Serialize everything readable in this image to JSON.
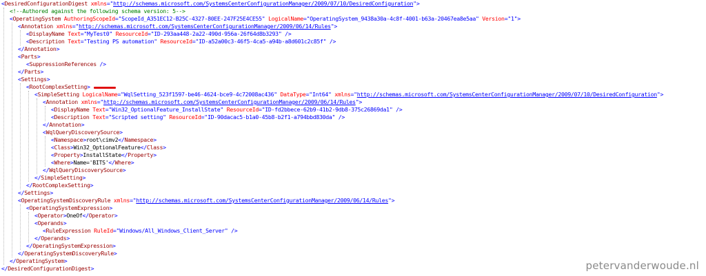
{
  "document": {
    "lines": [
      {
        "indent": 0,
        "parts": [
          [
            "tb",
            "<"
          ],
          [
            "tn",
            "DesiredConfigurationDigest"
          ],
          [
            "tx",
            " "
          ],
          [
            "an",
            "xmlns"
          ],
          [
            "tb",
            "=\""
          ],
          [
            "url",
            "http://schemas.microsoft.com/SystemsCenterConfigurationManager/2009/07/10/DesiredConfiguration"
          ],
          [
            "tb",
            "\">"
          ]
        ]
      },
      {
        "indent": 1,
        "parts": [
          [
            "cm",
            "<!--Authored against the following schema version: 5-->"
          ]
        ]
      },
      {
        "indent": 1,
        "parts": [
          [
            "tb",
            "<"
          ],
          [
            "tn",
            "OperatingSystem"
          ],
          [
            "tx",
            " "
          ],
          [
            "an",
            "AuthoringScopeId"
          ],
          [
            "tb",
            "=\""
          ],
          [
            "av",
            "ScopeId_A351EC12-B25C-4327-80EE-247F25E4CE55"
          ],
          [
            "tb",
            "\""
          ],
          [
            "tx",
            " "
          ],
          [
            "an",
            "LogicalName"
          ],
          [
            "tb",
            "=\""
          ],
          [
            "av",
            "OperatingSystem_9438a30a-4c8f-4001-b63a-20467ea8e5aa"
          ],
          [
            "tb",
            "\""
          ],
          [
            "tx",
            " "
          ],
          [
            "an",
            "Version"
          ],
          [
            "tb",
            "=\""
          ],
          [
            "av",
            "1"
          ],
          [
            "tb",
            "\">"
          ]
        ]
      },
      {
        "indent": 2,
        "parts": [
          [
            "tb",
            "<"
          ],
          [
            "tn",
            "Annotation"
          ],
          [
            "tx",
            " "
          ],
          [
            "an",
            "xmlns"
          ],
          [
            "tb",
            "=\""
          ],
          [
            "url",
            "http://schemas.microsoft.com/SystemsCenterConfigurationManager/2009/06/14/Rules"
          ],
          [
            "tb",
            "\">"
          ]
        ]
      },
      {
        "indent": 3,
        "parts": [
          [
            "tb",
            "<"
          ],
          [
            "tn",
            "DisplayName"
          ],
          [
            "tx",
            " "
          ],
          [
            "an",
            "Text"
          ],
          [
            "tb",
            "=\""
          ],
          [
            "av",
            "MyTest0"
          ],
          [
            "tb",
            "\""
          ],
          [
            "tx",
            " "
          ],
          [
            "an",
            "ResourceId"
          ],
          [
            "tb",
            "=\""
          ],
          [
            "av",
            "ID-293aa448-2a22-490d-956a-26f64d8b3293"
          ],
          [
            "tb",
            "\" />"
          ]
        ]
      },
      {
        "indent": 3,
        "parts": [
          [
            "tb",
            "<"
          ],
          [
            "tn",
            "Description"
          ],
          [
            "tx",
            " "
          ],
          [
            "an",
            "Text"
          ],
          [
            "tb",
            "=\""
          ],
          [
            "av",
            "Testing PS automation"
          ],
          [
            "tb",
            "\""
          ],
          [
            "tx",
            " "
          ],
          [
            "an",
            "ResourceId"
          ],
          [
            "tb",
            "=\""
          ],
          [
            "av",
            "ID-a52a00c3-46f5-4ca5-a94b-a8d601c2c85f"
          ],
          [
            "tb",
            "\" />"
          ]
        ]
      },
      {
        "indent": 2,
        "parts": [
          [
            "tb",
            "</"
          ],
          [
            "tn",
            "Annotation"
          ],
          [
            "tb",
            ">"
          ]
        ]
      },
      {
        "indent": 2,
        "parts": [
          [
            "tb",
            "<"
          ],
          [
            "tn",
            "Parts"
          ],
          [
            "tb",
            ">"
          ]
        ]
      },
      {
        "indent": 3,
        "parts": [
          [
            "tb",
            "<"
          ],
          [
            "tn",
            "SuppressionReferences"
          ],
          [
            "tb",
            " />"
          ]
        ]
      },
      {
        "indent": 2,
        "parts": [
          [
            "tb",
            "</"
          ],
          [
            "tn",
            "Parts"
          ],
          [
            "tb",
            ">"
          ]
        ]
      },
      {
        "indent": 2,
        "parts": [
          [
            "tb",
            "<"
          ],
          [
            "tn",
            "Settings"
          ],
          [
            "tb",
            ">"
          ]
        ]
      },
      {
        "indent": 3,
        "parts": [
          [
            "tb",
            "<"
          ],
          [
            "tn",
            "RootComplexSetting"
          ],
          [
            "tb",
            ">"
          ]
        ]
      },
      {
        "indent": 4,
        "parts": [
          [
            "tb",
            "<"
          ],
          [
            "tn",
            "SimpleSetting"
          ],
          [
            "tx",
            " "
          ],
          [
            "an",
            "LogicalName"
          ],
          [
            "tb",
            "=\""
          ],
          [
            "av",
            "WqlSetting_523f1597-be46-4624-bce9-4c72008ac436"
          ],
          [
            "tb",
            "\""
          ],
          [
            "tx",
            " "
          ],
          [
            "an",
            "DataType"
          ],
          [
            "tb",
            "=\""
          ],
          [
            "av",
            "Int64"
          ],
          [
            "tb",
            "\""
          ],
          [
            "tx",
            " "
          ],
          [
            "an",
            "xmlns"
          ],
          [
            "tb",
            "=\""
          ],
          [
            "url",
            "http://schemas.microsoft.com/SystemsCenterConfigurationManager/2009/07/10/DesiredConfiguration"
          ],
          [
            "tb",
            "\">"
          ]
        ]
      },
      {
        "indent": 5,
        "parts": [
          [
            "tb",
            "<"
          ],
          [
            "tn",
            "Annotation"
          ],
          [
            "tx",
            " "
          ],
          [
            "an",
            "xmlns"
          ],
          [
            "tb",
            "=\""
          ],
          [
            "url",
            "http://schemas.microsoft.com/SystemsCenterConfigurationManager/2009/06/14/Rules"
          ],
          [
            "tb",
            "\">"
          ]
        ]
      },
      {
        "indent": 6,
        "parts": [
          [
            "tb",
            "<"
          ],
          [
            "tn",
            "DisplayName"
          ],
          [
            "tx",
            " "
          ],
          [
            "an",
            "Text"
          ],
          [
            "tb",
            "=\""
          ],
          [
            "av",
            "Win32_OptionalFeature_InstallState"
          ],
          [
            "tb",
            "\""
          ],
          [
            "tx",
            " "
          ],
          [
            "an",
            "ResourceId"
          ],
          [
            "tb",
            "=\""
          ],
          [
            "av",
            "ID-fd2bbece-62b9-41b2-9db8-375c26869da1"
          ],
          [
            "tb",
            "\" />"
          ]
        ]
      },
      {
        "indent": 6,
        "parts": [
          [
            "tb",
            "<"
          ],
          [
            "tn",
            "Description"
          ],
          [
            "tx",
            " "
          ],
          [
            "an",
            "Text"
          ],
          [
            "tb",
            "=\""
          ],
          [
            "av",
            "Scripted setting"
          ],
          [
            "tb",
            "\""
          ],
          [
            "tx",
            " "
          ],
          [
            "an",
            "ResourceId"
          ],
          [
            "tb",
            "=\""
          ],
          [
            "av",
            "ID-90dacac5-b1a0-45b8-b2f1-a794bbd830da"
          ],
          [
            "tb",
            "\" />"
          ]
        ]
      },
      {
        "indent": 5,
        "parts": [
          [
            "tb",
            "</"
          ],
          [
            "tn",
            "Annotation"
          ],
          [
            "tb",
            ">"
          ]
        ]
      },
      {
        "indent": 5,
        "parts": [
          [
            "tb",
            "<"
          ],
          [
            "tn",
            "WqlQueryDiscoverySource"
          ],
          [
            "tb",
            ">"
          ]
        ]
      },
      {
        "indent": 6,
        "parts": [
          [
            "tb",
            "<"
          ],
          [
            "tn",
            "Namespace"
          ],
          [
            "tb",
            ">"
          ],
          [
            "tx",
            "root\\cimv2"
          ],
          [
            "tb",
            "</"
          ],
          [
            "tn",
            "Namespace"
          ],
          [
            "tb",
            ">"
          ]
        ]
      },
      {
        "indent": 6,
        "parts": [
          [
            "tb",
            "<"
          ],
          [
            "tn",
            "Class"
          ],
          [
            "tb",
            ">"
          ],
          [
            "tx",
            "Win32_OptionalFeature"
          ],
          [
            "tb",
            "</"
          ],
          [
            "tn",
            "Class"
          ],
          [
            "tb",
            ">"
          ]
        ]
      },
      {
        "indent": 6,
        "parts": [
          [
            "tb",
            "<"
          ],
          [
            "tn",
            "Property"
          ],
          [
            "tb",
            ">"
          ],
          [
            "tx",
            "InstallState"
          ],
          [
            "tb",
            "</"
          ],
          [
            "tn",
            "Property"
          ],
          [
            "tb",
            ">"
          ]
        ]
      },
      {
        "indent": 6,
        "parts": [
          [
            "tb",
            "<"
          ],
          [
            "tn",
            "Where"
          ],
          [
            "tb",
            ">"
          ],
          [
            "tx",
            "Name='BITS'"
          ],
          [
            "tb",
            "</"
          ],
          [
            "tn",
            "Where"
          ],
          [
            "tb",
            ">"
          ]
        ]
      },
      {
        "indent": 5,
        "parts": [
          [
            "tb",
            "</"
          ],
          [
            "tn",
            "WqlQueryDiscoverySource"
          ],
          [
            "tb",
            ">"
          ]
        ]
      },
      {
        "indent": 4,
        "parts": [
          [
            "tb",
            "</"
          ],
          [
            "tn",
            "SimpleSetting"
          ],
          [
            "tb",
            ">"
          ]
        ]
      },
      {
        "indent": 3,
        "parts": [
          [
            "tb",
            "</"
          ],
          [
            "tn",
            "RootComplexSetting"
          ],
          [
            "tb",
            ">"
          ]
        ]
      },
      {
        "indent": 2,
        "parts": [
          [
            "tb",
            "</"
          ],
          [
            "tn",
            "Settings"
          ],
          [
            "tb",
            ">"
          ]
        ]
      },
      {
        "indent": 2,
        "parts": [
          [
            "tb",
            "<"
          ],
          [
            "tn",
            "OperatingSystemDiscoveryRule"
          ],
          [
            "tx",
            " "
          ],
          [
            "an",
            "xmlns"
          ],
          [
            "tb",
            "=\""
          ],
          [
            "url",
            "http://schemas.microsoft.com/SystemsCenterConfigurationManager/2009/06/14/Rules"
          ],
          [
            "tb",
            "\">"
          ]
        ]
      },
      {
        "indent": 3,
        "parts": [
          [
            "tb",
            "<"
          ],
          [
            "tn",
            "OperatingSystemExpression"
          ],
          [
            "tb",
            ">"
          ]
        ]
      },
      {
        "indent": 4,
        "parts": [
          [
            "tb",
            "<"
          ],
          [
            "tn",
            "Operator"
          ],
          [
            "tb",
            ">"
          ],
          [
            "tx",
            "OneOf"
          ],
          [
            "tb",
            "</"
          ],
          [
            "tn",
            "Operator"
          ],
          [
            "tb",
            ">"
          ]
        ]
      },
      {
        "indent": 4,
        "parts": [
          [
            "tb",
            "<"
          ],
          [
            "tn",
            "Operands"
          ],
          [
            "tb",
            ">"
          ]
        ]
      },
      {
        "indent": 5,
        "parts": [
          [
            "tb",
            "<"
          ],
          [
            "tn",
            "RuleExpression"
          ],
          [
            "tx",
            " "
          ],
          [
            "an",
            "RuleId"
          ],
          [
            "tb",
            "=\""
          ],
          [
            "av",
            "Windows/All_Windows_Client_Server"
          ],
          [
            "tb",
            "\" />"
          ]
        ]
      },
      {
        "indent": 4,
        "parts": [
          [
            "tb",
            "</"
          ],
          [
            "tn",
            "Operands"
          ],
          [
            "tb",
            ">"
          ]
        ]
      },
      {
        "indent": 3,
        "parts": [
          [
            "tb",
            "</"
          ],
          [
            "tn",
            "OperatingSystemExpression"
          ],
          [
            "tb",
            ">"
          ]
        ]
      },
      {
        "indent": 2,
        "parts": [
          [
            "tb",
            "</"
          ],
          [
            "tn",
            "OperatingSystemDiscoveryRule"
          ],
          [
            "tb",
            ">"
          ]
        ]
      },
      {
        "indent": 1,
        "parts": [
          [
            "tb",
            "</"
          ],
          [
            "tn",
            "OperatingSystem"
          ],
          [
            "tb",
            ">"
          ]
        ]
      },
      {
        "indent": 0,
        "parts": [
          [
            "tb",
            "</"
          ],
          [
            "tn",
            "DesiredConfigurationDigest"
          ],
          [
            "tb",
            ">"
          ]
        ]
      }
    ]
  },
  "watermark": "petervanderwoude.nl",
  "colors": {
    "tag_bracket": "#0000ff",
    "tag_name": "#990000",
    "attribute_name": "#ff0000",
    "attribute_value": "#0000ff",
    "comment": "#008000",
    "text": "#000000",
    "highlight_marker": "#e01010"
  }
}
